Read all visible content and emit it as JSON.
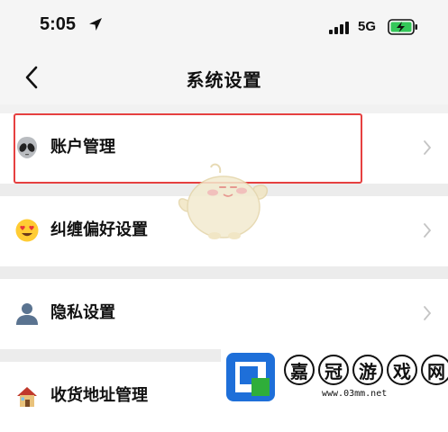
{
  "status_bar": {
    "time": "5:05",
    "network": "5G"
  },
  "nav": {
    "title": "系统设置"
  },
  "settings": {
    "items": [
      {
        "icon": "alien-icon",
        "label": "账户管理"
      },
      {
        "icon": "heart-eyes-icon",
        "label": "纠缠偏好设置"
      },
      {
        "icon": "user-icon",
        "label": "隐私设置"
      },
      {
        "icon": "house-icon",
        "label": "收货地址管理"
      }
    ]
  },
  "watermark": {
    "chars": [
      "嘉",
      "冠",
      "游",
      "戏",
      "网"
    ],
    "url": "www.03mm.net"
  },
  "colors": {
    "highlight": "#e64040",
    "battery": "#34c759",
    "logo_blue": "#1e6fd9",
    "logo_green": "#2fae3a"
  }
}
